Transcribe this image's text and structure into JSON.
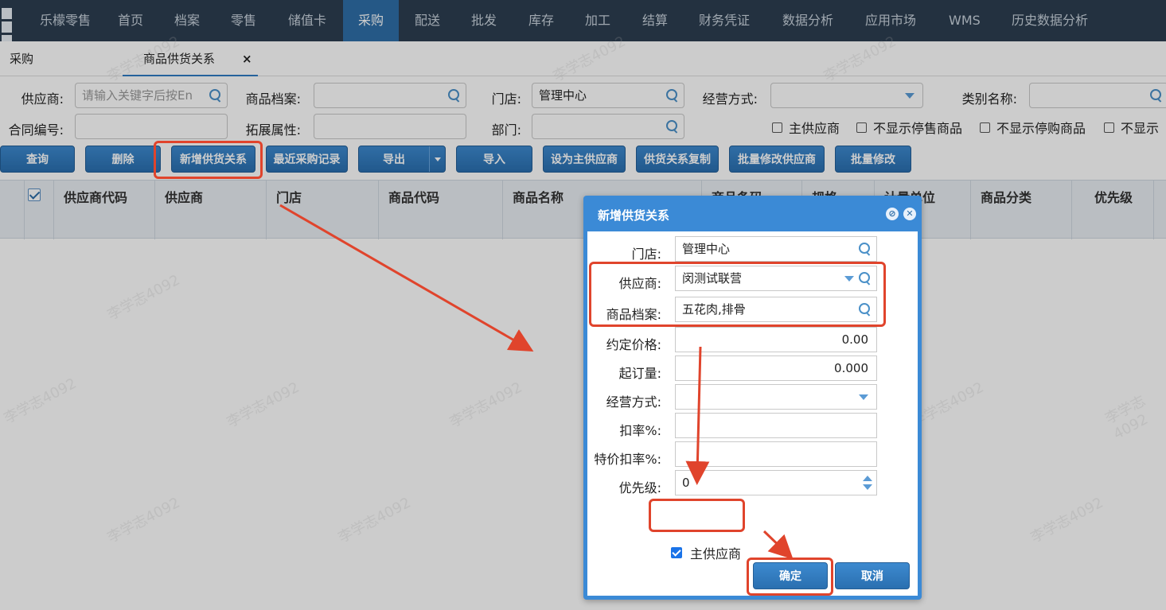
{
  "nav": {
    "items": [
      "乐檬零售",
      "首页",
      "档案",
      "零售",
      "储值卡",
      "采购",
      "配送",
      "批发",
      "库存",
      "加工",
      "结算",
      "财务凭证",
      "数据分析",
      "应用市场",
      "WMS",
      "历史数据分析"
    ],
    "active": "采购"
  },
  "tabs": {
    "t1": "采购",
    "t2": "商品供货关系",
    "close": "×"
  },
  "filters": {
    "supplier_label": "供应商:",
    "supplier_placeholder": "请输入关键字后按En",
    "product_label": "商品档案:",
    "store_label": "门店:",
    "store_value": "管理中心",
    "mode_label": "经营方式:",
    "category_label": "类别名称:",
    "contract_label": "合同编号:",
    "ext_label": "拓展属性:",
    "dept_label": "部门:",
    "chk_main": "主供应商",
    "chk_no_sale": "不显示停售商品",
    "chk_no_purchase": "不显示停购商品",
    "chk_no_show": "不显示"
  },
  "toolbar": {
    "query": "查询",
    "delete": "删除",
    "add": "新增供货关系",
    "recent": "最近采购记录",
    "export": "导出",
    "import": "导入",
    "set_main": "设为主供应商",
    "copy": "供货关系复制",
    "batch_supplier": "批量修改供应商",
    "batch": "批量修改"
  },
  "columns": [
    "供应商代码",
    "供应商",
    "门店",
    "商品代码",
    "商品名称",
    "商品条码",
    "规格",
    "计量单位",
    "商品分类",
    "优先级"
  ],
  "dialog": {
    "title": "新增供货关系",
    "store_label": "门店:",
    "store_value": "管理中心",
    "supplier_label": "供应商:",
    "supplier_value": "闵测试联营",
    "product_label": "商品档案:",
    "product_value": "五花肉,排骨",
    "price_label": "约定价格:",
    "price_value": "0.00",
    "moq_label": "起订量:",
    "moq_value": "0.000",
    "mode_label": "经营方式:",
    "discount_label": "扣率%:",
    "special_label": "特价扣率%:",
    "priority_label": "优先级:",
    "priority_value": "0",
    "main_supplier": "主供应商",
    "ok": "确定",
    "cancel": "取消"
  },
  "watermark": "李学志4092"
}
